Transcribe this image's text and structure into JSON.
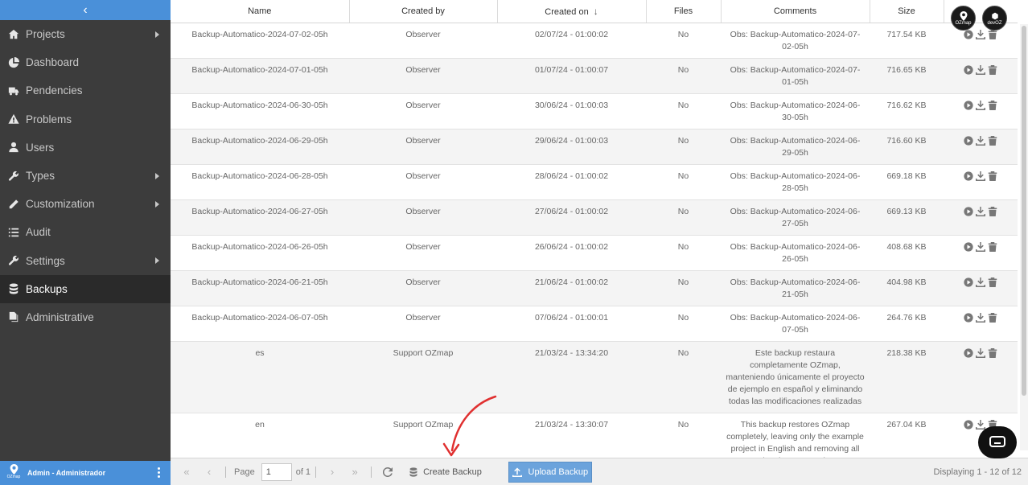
{
  "sidebar": {
    "collapse_glyph": "‹",
    "items": [
      {
        "label": "Projects",
        "icon": "home-icon",
        "has_submenu": true
      },
      {
        "label": "Dashboard",
        "icon": "pie-chart-icon",
        "has_submenu": false
      },
      {
        "label": "Pendencies",
        "icon": "truck-clock-icon",
        "has_submenu": false
      },
      {
        "label": "Problems",
        "icon": "warning-icon",
        "has_submenu": false
      },
      {
        "label": "Users",
        "icon": "user-icon",
        "has_submenu": false
      },
      {
        "label": "Types",
        "icon": "wrench-icon",
        "has_submenu": true
      },
      {
        "label": "Customization",
        "icon": "pencil-icon",
        "has_submenu": true
      },
      {
        "label": "Audit",
        "icon": "list-icon",
        "has_submenu": false
      },
      {
        "label": "Settings",
        "icon": "wrench-icon",
        "has_submenu": true
      },
      {
        "label": "Backups",
        "icon": "database-icon",
        "has_submenu": false,
        "active": true
      },
      {
        "label": "Administrative",
        "icon": "copy-icon",
        "has_submenu": false
      }
    ],
    "user": {
      "name": "Admin - Administrador",
      "logo_text": "OZmap"
    }
  },
  "header_logos": [
    {
      "text": "OZmap"
    },
    {
      "text": "devOZ"
    }
  ],
  "table": {
    "columns": [
      "Name",
      "Created by",
      "Created on",
      "Files",
      "Comments",
      "Size",
      ""
    ],
    "sort_column": "Created on",
    "sort_glyph": "↓",
    "rows": [
      {
        "name": "Backup-Automatico-2024-07-02-05h",
        "created_by": "Observer",
        "created_on": "02/07/24 - 01:00:02",
        "files": "No",
        "comments": "Obs: Backup-Automatico-2024-07-02-05h",
        "size": "717.54 KB"
      },
      {
        "name": "Backup-Automatico-2024-07-01-05h",
        "created_by": "Observer",
        "created_on": "01/07/24 - 01:00:07",
        "files": "No",
        "comments": "Obs: Backup-Automatico-2024-07-01-05h",
        "size": "716.65 KB"
      },
      {
        "name": "Backup-Automatico-2024-06-30-05h",
        "created_by": "Observer",
        "created_on": "30/06/24 - 01:00:03",
        "files": "No",
        "comments": "Obs: Backup-Automatico-2024-06-30-05h",
        "size": "716.62 KB"
      },
      {
        "name": "Backup-Automatico-2024-06-29-05h",
        "created_by": "Observer",
        "created_on": "29/06/24 - 01:00:03",
        "files": "No",
        "comments": "Obs: Backup-Automatico-2024-06-29-05h",
        "size": "716.60 KB"
      },
      {
        "name": "Backup-Automatico-2024-06-28-05h",
        "created_by": "Observer",
        "created_on": "28/06/24 - 01:00:02",
        "files": "No",
        "comments": "Obs: Backup-Automatico-2024-06-28-05h",
        "size": "669.18 KB"
      },
      {
        "name": "Backup-Automatico-2024-06-27-05h",
        "created_by": "Observer",
        "created_on": "27/06/24 - 01:00:02",
        "files": "No",
        "comments": "Obs: Backup-Automatico-2024-06-27-05h",
        "size": "669.13 KB"
      },
      {
        "name": "Backup-Automatico-2024-06-26-05h",
        "created_by": "Observer",
        "created_on": "26/06/24 - 01:00:02",
        "files": "No",
        "comments": "Obs: Backup-Automatico-2024-06-26-05h",
        "size": "408.68 KB"
      },
      {
        "name": "Backup-Automatico-2024-06-21-05h",
        "created_by": "Observer",
        "created_on": "21/06/24 - 01:00:02",
        "files": "No",
        "comments": "Obs: Backup-Automatico-2024-06-21-05h",
        "size": "404.98 KB"
      },
      {
        "name": "Backup-Automatico-2024-06-07-05h",
        "created_by": "Observer",
        "created_on": "07/06/24 - 01:00:01",
        "files": "No",
        "comments": "Obs: Backup-Automatico-2024-06-07-05h",
        "size": "264.76 KB"
      },
      {
        "name": "es",
        "created_by": "Support OZmap",
        "created_on": "21/03/24 - 13:34:20",
        "files": "No",
        "comments": "Este backup restaura completamente OZmap, manteniendo únicamente el proyecto de ejemplo en español y eliminando todas las modificaciones realizadas",
        "size": "218.38 KB"
      },
      {
        "name": "en",
        "created_by": "Support OZmap",
        "created_on": "21/03/24 - 13:30:07",
        "files": "No",
        "comments": "This backup restores OZmap completely, leaving only the example project in English and removing all the changes made",
        "size": "267.04 KB"
      }
    ]
  },
  "pager": {
    "page_label": "Page",
    "page_value": "1",
    "of_label": "of 1",
    "create_label": "Create Backup",
    "upload_label": "Upload Backup",
    "display_text": "Displaying 1 - 12 of 12"
  },
  "colors": {
    "sidebar_bg": "#3c3c3c",
    "accent": "#4a90d9",
    "annotation_arrow": "#e03030"
  }
}
